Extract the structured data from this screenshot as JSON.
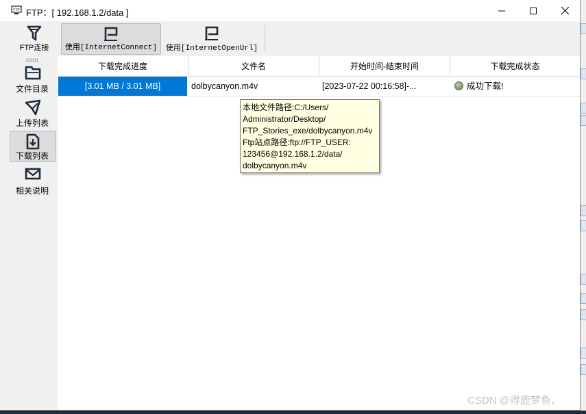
{
  "window": {
    "title": "FTP：[ 192.168.1.2/data ]",
    "app_icon": "ftp-monitor-icon",
    "controls": [
      "minimize-icon",
      "maximize-icon",
      "close-icon"
    ]
  },
  "toolbar": {
    "items": [
      {
        "label": "FTP连接",
        "icon": "funnel-icon",
        "active": false
      },
      {
        "label": "使用[InternetConnect]",
        "icon": "flag-icon",
        "active": true
      },
      {
        "label": "使用[InternetOpenUrl]",
        "icon": "flag-icon",
        "active": false
      }
    ]
  },
  "sidebar": {
    "items": [
      {
        "label": "文件目录",
        "icon": "folder-icon",
        "active": false
      },
      {
        "label": "上传列表",
        "icon": "send-icon",
        "active": false
      },
      {
        "label": "下载列表",
        "icon": "download-icon",
        "active": true
      },
      {
        "label": "相关说明",
        "icon": "mail-icon",
        "active": false
      }
    ]
  },
  "table": {
    "columns": [
      "下载完成进度",
      "文件名",
      "开始时间-结束时间",
      "下载完成状态"
    ],
    "rows": [
      {
        "progress": "[3.01 MB / 3.01 MB]",
        "progress_fraction": 1.0,
        "filename": "dolbycanyon.m4v",
        "time": "[2023-07-22 00:16:58]-...",
        "status": "成功下载!",
        "status_color": "#8aa070"
      }
    ]
  },
  "tooltip": {
    "lines": [
      "本地文件路径:C:/Users/",
      "Administrator/Desktop/",
      "FTP_Stories_exe/dolbycanyon.m4v",
      "Ftp站点路径:ftp://FTP_USER:",
      "123456@192.168.1.2/data/",
      "dolbycanyon.m4v"
    ]
  },
  "watermark": "CSDN @得鹿梦鱼、",
  "colors": {
    "accent": "#0078d7",
    "tooltip_bg": "#ffffe1"
  }
}
